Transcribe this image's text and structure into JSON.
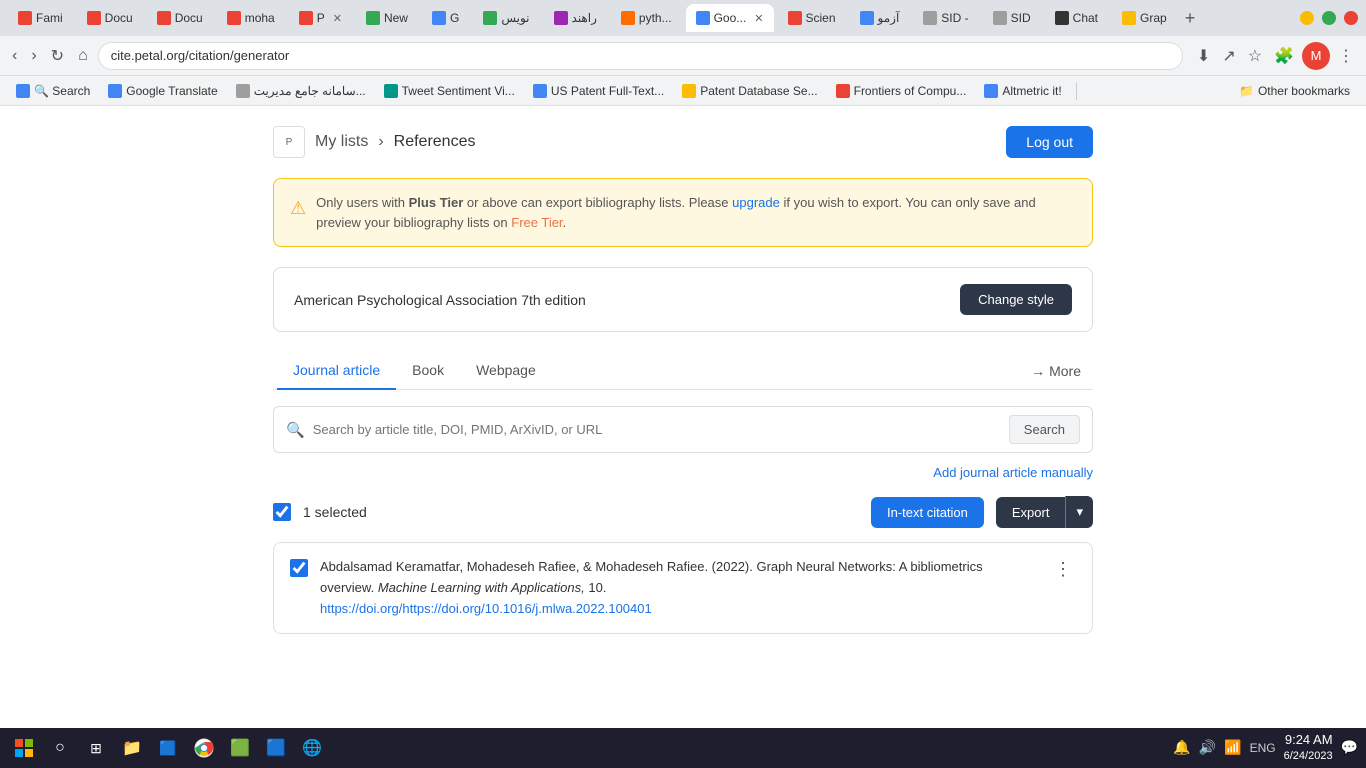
{
  "browser": {
    "tabs": [
      {
        "id": "fami",
        "label": "Fami",
        "favicon_color": "fav-red",
        "active": false
      },
      {
        "id": "docu1",
        "label": "Docu",
        "favicon_color": "fav-red",
        "active": false
      },
      {
        "id": "docu2",
        "label": "Docu",
        "favicon_color": "fav-red",
        "active": false
      },
      {
        "id": "moha",
        "label": "moha",
        "favicon_color": "fav-red",
        "active": false
      },
      {
        "id": "p",
        "label": "P",
        "favicon_color": "fav-red",
        "active": false
      },
      {
        "id": "new",
        "label": "New",
        "favicon_color": "fav-green",
        "active": false
      },
      {
        "id": "g",
        "label": "G",
        "favicon_color": "fav-blue",
        "active": false
      },
      {
        "id": "novis",
        "label": "نویس",
        "favicon_color": "fav-green",
        "active": false
      },
      {
        "id": "rahand",
        "label": "راهند",
        "favicon_color": "fav-purple",
        "active": false
      },
      {
        "id": "python",
        "label": "pyth...",
        "favicon_color": "fav-orange",
        "active": false
      },
      {
        "id": "goog",
        "label": "Goo...",
        "favicon_color": "fav-blue",
        "active": true
      },
      {
        "id": "scien",
        "label": "Scien",
        "favicon_color": "fav-red",
        "active": false
      },
      {
        "id": "azmo",
        "label": "آزمو",
        "favicon_color": "fav-blue",
        "active": false
      },
      {
        "id": "sid1",
        "label": "SID -",
        "favicon_color": "fav-gray",
        "active": false
      },
      {
        "id": "sid2",
        "label": "SID",
        "favicon_color": "fav-gray",
        "active": false
      },
      {
        "id": "chat",
        "label": "Chat",
        "favicon_color": "fav-dark",
        "active": false
      },
      {
        "id": "grap",
        "label": "Grap",
        "favicon_color": "fav-yellow",
        "active": false
      }
    ],
    "address": "cite.petal.org/citation/generator",
    "bookmarks": [
      {
        "label": "Search",
        "favicon_color": "fav-blue"
      },
      {
        "label": "Google Translate",
        "favicon_color": "fav-blue"
      },
      {
        "label": "سامانه جامع مدیریت...",
        "favicon_color": "fav-gray"
      },
      {
        "label": "Tweet Sentiment Vi...",
        "favicon_color": "fav-teal"
      },
      {
        "label": "US Patent Full-Text...",
        "favicon_color": "fav-blue"
      },
      {
        "label": "Patent Database Se...",
        "favicon_color": "fav-yellow"
      },
      {
        "label": "Frontiers of Compu...",
        "favicon_color": "fav-red"
      },
      {
        "label": "Altmetric it!",
        "favicon_color": "fav-blue"
      }
    ],
    "other_bookmarks_label": "Other bookmarks"
  },
  "header": {
    "logo_text": "Petal",
    "breadcrumb_my_lists": "My lists",
    "breadcrumb_references": "References",
    "logout_label": "Log out"
  },
  "warning": {
    "icon": "⚠",
    "text_before_bold": "Only users with ",
    "bold_text": "Plus Tier",
    "text_after_bold": " or above can export bibliography lists. Please ",
    "upgrade_link": "upgrade",
    "text_after_link": " if you wish to export. You can only save and preview your bibliography lists on ",
    "free_tier_text": "Free Tier",
    "text_end": "."
  },
  "citation_style": {
    "label": "American Psychological Association 7th edition",
    "change_style_label": "Change style"
  },
  "tabs": {
    "items": [
      {
        "id": "journal",
        "label": "Journal article",
        "active": true
      },
      {
        "id": "book",
        "label": "Book",
        "active": false
      },
      {
        "id": "webpage",
        "label": "Webpage",
        "active": false
      }
    ],
    "more_label": "More",
    "more_arrow": "→"
  },
  "search": {
    "placeholder": "Search by article title, DOI, PMID, ArXivID, or URL",
    "button_label": "Search"
  },
  "add_manually_label": "Add journal article manually",
  "selection": {
    "count_label": "1 selected",
    "in_text_citation_label": "In-text citation",
    "export_label": "Export"
  },
  "reference": {
    "authors": "Abdalsamad Keramatfar, Mohadeseh Rafiee, & Mohadeseh Rafiee. (2022). Graph Neural Networks: A bibliometrics overview.",
    "journal": "Machine Learning with Applications,",
    "volume": " 10.",
    "doi": "https://doi.org/https://doi.org/10.1016/j.mlwa.2022.100401"
  },
  "taskbar": {
    "time": "9:24 AM",
    "date": "6/24/2023",
    "lang": "ENG"
  }
}
